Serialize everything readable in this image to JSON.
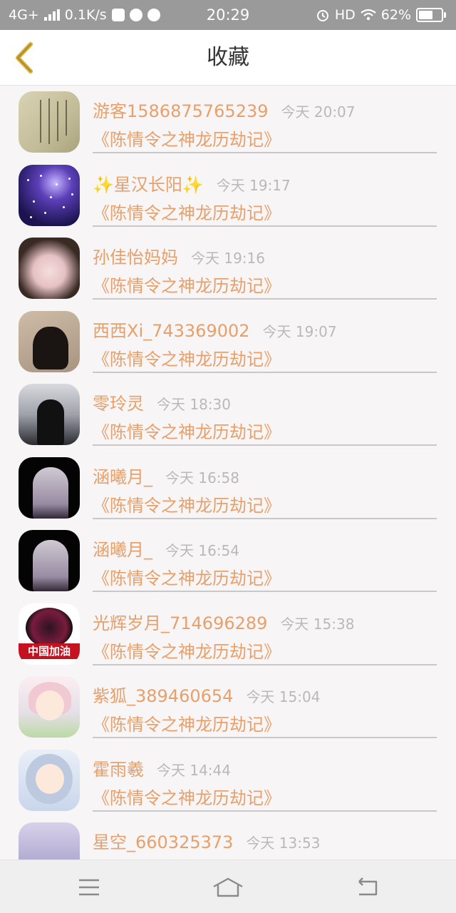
{
  "status_bar": {
    "network": "4G+",
    "speed": "0.1K/s",
    "time": "20:29",
    "hd": "HD",
    "battery": "62%",
    "battery_level": 0.62
  },
  "header": {
    "title": "收藏"
  },
  "items": [
    {
      "name": "游客1586875765239",
      "time": "今天 20:07",
      "title": "《陈情令之神龙历劫记》",
      "avatar": "paper"
    },
    {
      "name": "✨星汉长阳✨",
      "time": "今天 19:17",
      "title": "《陈情令之神龙历劫记》",
      "avatar": "galaxy"
    },
    {
      "name": "孙佳怡妈妈",
      "time": "今天 19:16",
      "title": "《陈情令之神龙历劫记》",
      "avatar": "girl"
    },
    {
      "name": "西西Xi_743369002",
      "time": "今天 19:07",
      "title": "《陈情令之神龙历劫记》",
      "avatar": "shadow"
    },
    {
      "name": "零玲灵",
      "time": "今天 18:30",
      "title": "《陈情令之神龙历劫记》",
      "avatar": "girl2"
    },
    {
      "name": "涵曦月_",
      "time": "今天 16:58",
      "title": "《陈情令之神龙历劫记》",
      "avatar": "ghost"
    },
    {
      "name": "涵曦月_",
      "time": "今天 16:54",
      "title": "《陈情令之神龙历劫记》",
      "avatar": "ghost"
    },
    {
      "name": "光辉岁月_714696289",
      "time": "今天 15:38",
      "title": "《陈情令之神龙历劫记》",
      "avatar": "moon",
      "avatar_text": "中国加油"
    },
    {
      "name": "紫狐_389460654",
      "time": "今天 15:04",
      "title": "《陈情令之神龙历劫记》",
      "avatar": "anime1"
    },
    {
      "name": "霍雨羲",
      "time": "今天 14:44",
      "title": "《陈情令之神龙历劫记》",
      "avatar": "anime2"
    },
    {
      "name": "星空_660325373",
      "time": "今天 13:53",
      "title": "《陈情令之神龙历劫记》",
      "avatar": "anime3"
    }
  ],
  "nav": {
    "menu_icon": "menu-icon",
    "home_icon": "home-icon",
    "back_icon": "return-icon"
  },
  "colors": {
    "accent": "#e8a06a",
    "time": "#b9b9b9",
    "back_arrow": "#d9b23a"
  }
}
